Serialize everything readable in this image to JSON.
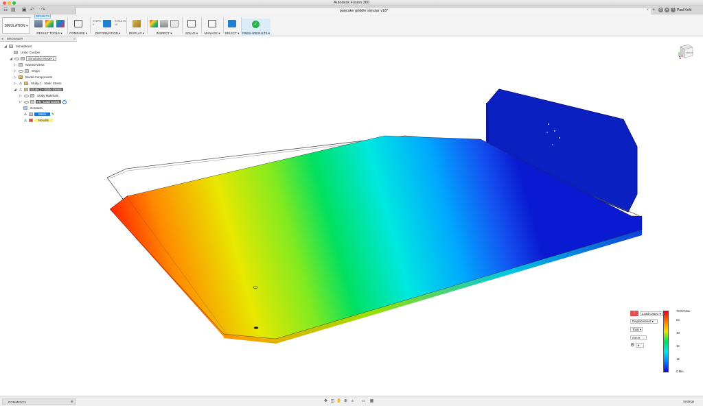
{
  "window": {
    "app_title": "Autodesk Fusion 360",
    "document_title": "pancake griddle simular v18*",
    "user_name": "Paul Kehl"
  },
  "ribbon": {
    "workspace": "SIMULATION ▾",
    "active_tab": "RESULTS",
    "groups": [
      {
        "label": "RESULT TOOLS ▾"
      },
      {
        "label": "COMPARE ▾"
      },
      {
        "label": "DEFORMATION ▾"
      },
      {
        "label": "DISPLAY ▾"
      },
      {
        "label": "INSPECT ▾"
      },
      {
        "label": "SOLVE ▾"
      },
      {
        "label": "MANAGE ▾"
      },
      {
        "label": "SELECT ▾"
      },
      {
        "label": "FINISH RESULTS ▾"
      }
    ],
    "deformation_small": [
      "STEPS",
      "0",
      "RESULTS",
      "1X"
    ]
  },
  "browser": {
    "title": "BROWSER",
    "items": [
      {
        "label": "Simulations"
      },
      {
        "label": "Units: Custom"
      },
      {
        "label": "Simulation Model 1"
      },
      {
        "label": "Named Views"
      },
      {
        "label": "Origin"
      },
      {
        "label": "Model Components"
      },
      {
        "label": "Study 1 - Static Stress"
      },
      {
        "label": "Study 2 - Static Stress"
      },
      {
        "label": "Study Materials"
      },
      {
        "label": "Load Case1"
      },
      {
        "label": "Contacts"
      },
      {
        "label": "Mesh"
      },
      {
        "label": "Results"
      }
    ],
    "load_case_prefix": "FS"
  },
  "viewcube": {
    "face_label": "FRONT"
  },
  "legend": {
    "load_case": "Load Case1 ▾",
    "result_type": "Displacement ▾",
    "component": "Total ▾",
    "units": "mm ▾",
    "max_label": "76.08 Max.",
    "ticks": [
      "64",
      "48",
      "32",
      "16"
    ],
    "min_label": "0 Min.",
    "colors": {
      "max": "#e8001a",
      "mid": "#00e060",
      "min": "#1400e0"
    }
  },
  "bottombar": {
    "comments_label": "COMMENTS",
    "settings_label": "Settings"
  },
  "colors": {
    "accent": "#1f77d0",
    "warning": "#ffd400",
    "finish": "#27b24a"
  }
}
